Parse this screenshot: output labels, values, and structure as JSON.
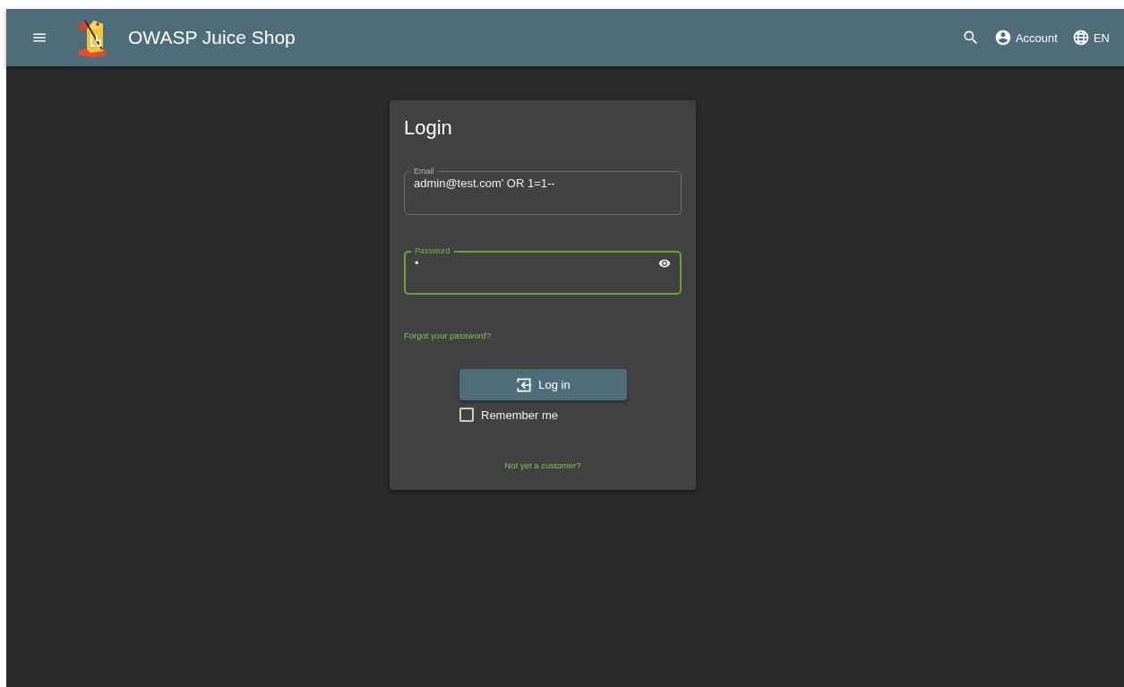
{
  "toolbar": {
    "title": "OWASP Juice Shop",
    "account": "Account",
    "language": "EN"
  },
  "login": {
    "title": "Login",
    "email": {
      "label": "Email",
      "value": "admin@test.com' OR 1=1--",
      "focused": false
    },
    "password": {
      "label": "Password",
      "value": "•",
      "focused": true
    },
    "forgot": "Forgot your password?",
    "button": "Log in",
    "remember": {
      "label": "Remember me",
      "checked": false
    },
    "register": "Not yet a customer?"
  }
}
